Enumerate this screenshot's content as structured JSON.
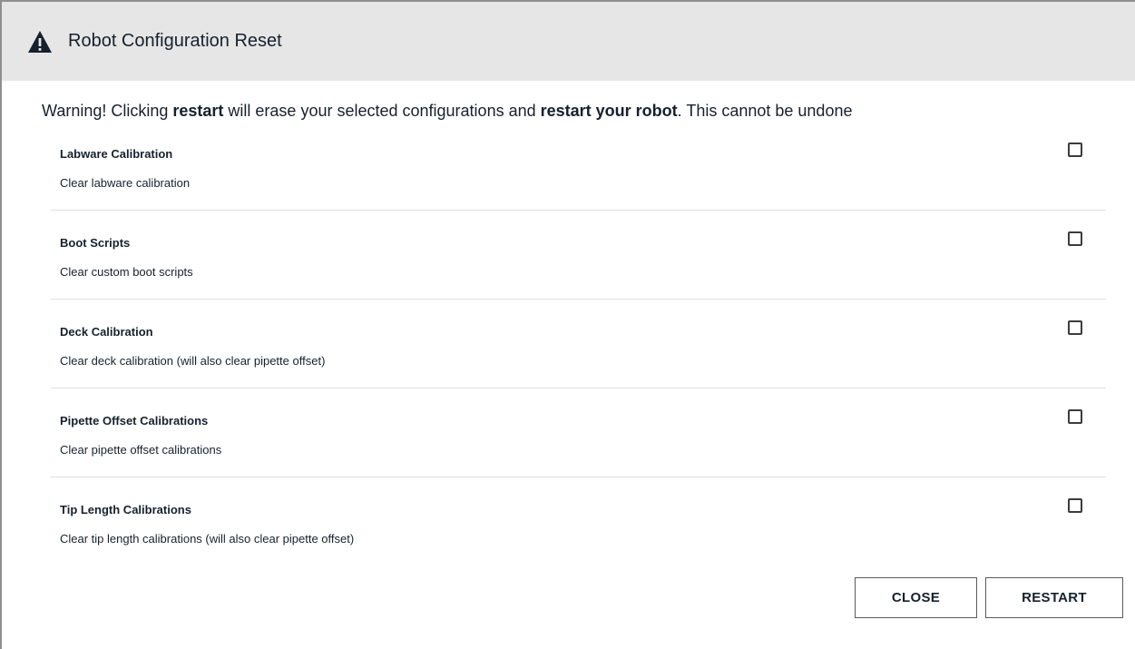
{
  "dialog": {
    "title": "Robot Configuration Reset",
    "icon": "alert-triangle-icon"
  },
  "warning": {
    "part1": "Warning! Clicking ",
    "bold1": "restart",
    "part2": " will erase your selected configurations and ",
    "bold2": "restart your robot",
    "part3": ". This cannot be undone"
  },
  "options": [
    {
      "name": "Labware Calibration",
      "description": "Clear labware calibration",
      "checked": false
    },
    {
      "name": "Boot Scripts",
      "description": "Clear custom boot scripts",
      "checked": false
    },
    {
      "name": "Deck Calibration",
      "description": "Clear deck calibration (will also clear pipette offset)",
      "checked": false
    },
    {
      "name": "Pipette Offset Calibrations",
      "description": "Clear pipette offset calibrations",
      "checked": false
    },
    {
      "name": "Tip Length Calibrations",
      "description": "Clear tip length calibrations (will also clear pipette offset)",
      "checked": false
    }
  ],
  "buttons": {
    "close": "CLOSE",
    "restart": "RESTART"
  },
  "colors": {
    "header_bg": "#e6e6e6",
    "text": "#16212d",
    "divider": "#e0e0e0"
  }
}
